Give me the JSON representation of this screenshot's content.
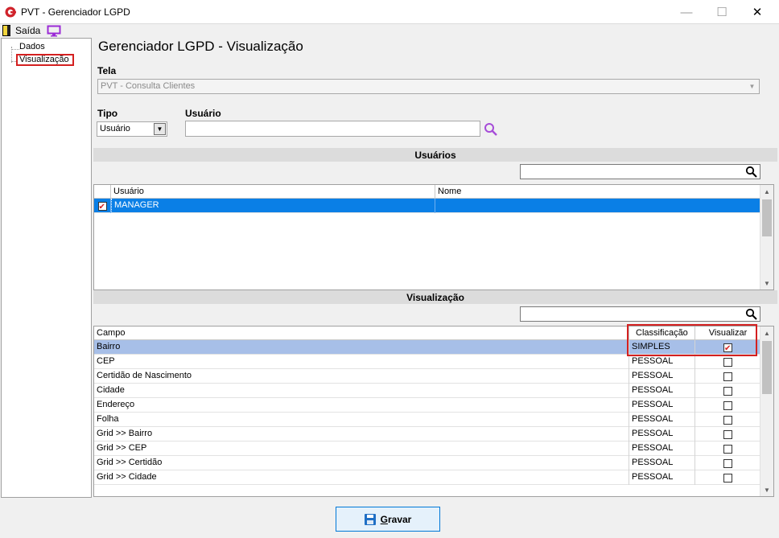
{
  "window": {
    "title": "PVT - Gerenciador LGPD",
    "minimize": "—",
    "maximize": "☐",
    "close": "✕"
  },
  "menu": {
    "exit_label": "Saída",
    "exit_icon": "exit-door-icon",
    "monitor_icon": "monitor-icon"
  },
  "tree": {
    "items": [
      "Dados",
      "Visualização"
    ],
    "selected": "Visualização"
  },
  "page": {
    "title": "Gerenciador LGPD - Visualização"
  },
  "form": {
    "tela_label": "Tela",
    "tela_value": "PVT - Consulta Clientes",
    "tipo_label": "Tipo",
    "tipo_value": "Usuário",
    "usuario_label": "Usuário",
    "usuario_value": ""
  },
  "users_section": {
    "title": "Usuários",
    "search_value": "",
    "columns": [
      "Usuário",
      "Nome"
    ],
    "rows": [
      {
        "checked": true,
        "usuario": "MANAGER",
        "nome": ""
      }
    ]
  },
  "view_section": {
    "title": "Visualização",
    "search_value": "",
    "columns": [
      "Campo",
      "Classificação",
      "Visualizar"
    ],
    "rows": [
      {
        "campo": "Bairro",
        "classificacao": "SIMPLES",
        "visualizar": true
      },
      {
        "campo": "CEP",
        "classificacao": "PESSOAL",
        "visualizar": false
      },
      {
        "campo": "Certidão de Nascimento",
        "classificacao": "PESSOAL",
        "visualizar": false
      },
      {
        "campo": "Cidade",
        "classificacao": "PESSOAL",
        "visualizar": false
      },
      {
        "campo": "Endereço",
        "classificacao": "PESSOAL",
        "visualizar": false
      },
      {
        "campo": "Folha",
        "classificacao": "PESSOAL",
        "visualizar": false
      },
      {
        "campo": "Grid >> Bairro",
        "classificacao": "PESSOAL",
        "visualizar": false
      },
      {
        "campo": "Grid >> CEP",
        "classificacao": "PESSOAL",
        "visualizar": false
      },
      {
        "campo": "Grid >> Certidão",
        "classificacao": "PESSOAL",
        "visualizar": false
      },
      {
        "campo": "Grid >> Cidade",
        "classificacao": "PESSOAL",
        "visualizar": false
      }
    ]
  },
  "actions": {
    "save_label_underlined": "G",
    "save_label_rest": "ravar",
    "save_icon": "floppy-disk-icon"
  },
  "colors": {
    "selection": "#0a7fe6",
    "row_highlight": "#a7bfe8",
    "highlight_border": "#d42020",
    "accent": "#1f6fc5"
  }
}
